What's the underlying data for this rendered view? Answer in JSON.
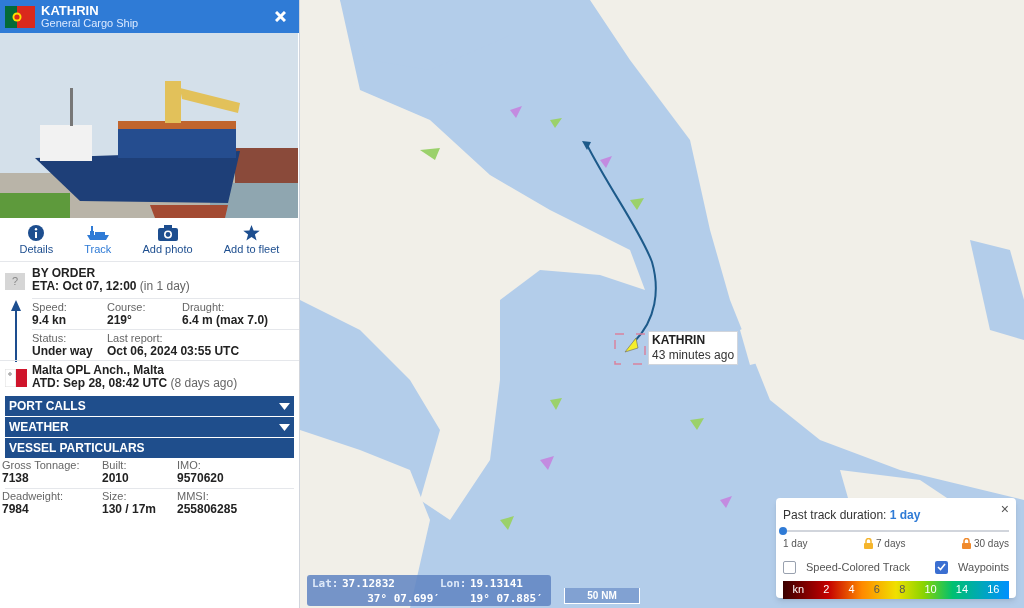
{
  "vessel": {
    "name": "KATHRIN",
    "type": "General Cargo Ship"
  },
  "actions": [
    {
      "kind": "info",
      "label": "Details"
    },
    {
      "kind": "track",
      "label": "Track"
    },
    {
      "kind": "camera",
      "label": "Add photo"
    },
    {
      "kind": "star",
      "label": "Add to fleet"
    }
  ],
  "voyage": {
    "destination_flag": "?",
    "destination": "BY ORDER",
    "eta": "ETA: Oct 07, 12:00",
    "eta_note": "(in 1 day)",
    "stats": [
      [
        {
          "label": "Speed:",
          "value": "9.4 kn"
        },
        {
          "label": "Course:",
          "value": "219°"
        },
        {
          "label": "Draught:",
          "value": "6.4 m (max 7.0)"
        }
      ],
      [
        {
          "label": "Status:",
          "value": "Under way"
        },
        {
          "label": "Last report:",
          "value": "Oct 06, 2024 03:55 UTC"
        }
      ]
    ],
    "departure": "Malta OPL Anch., Malta",
    "atd": "ATD: Sep 28, 08:42 UTC",
    "atd_note": "(8 days ago)"
  },
  "sections": [
    {
      "title": "PORT CALLS",
      "expanded": false
    },
    {
      "title": "WEATHER",
      "expanded": false
    },
    {
      "title": "VESSEL PARTICULARS",
      "expanded": true
    }
  ],
  "particulars": [
    [
      {
        "label": "Gross Tonnage:",
        "value": "7138"
      },
      {
        "label": "Built:",
        "value": "2010"
      },
      {
        "label": "IMO:",
        "value": "9570620"
      }
    ],
    [
      {
        "label": "Deadweight:",
        "value": "7984"
      },
      {
        "label": "Size:",
        "value": "130 / 17m"
      },
      {
        "label": "MMSI:",
        "value": "255806285"
      }
    ]
  ],
  "map": {
    "kind": "picture",
    "tooltip": {
      "name": "KATHRIN",
      "time": "43 minutes ago"
    },
    "coordinates": {
      "lat_label": "Lat:",
      "lat": "37.12832",
      "lat_dms": "37° 07.699′",
      "lon_label": "Lon:",
      "lon": "19.13141",
      "lon_dms": "19° 07.885′"
    },
    "scale": "50 NM"
  },
  "track_panel": {
    "title": "Past track duration:",
    "value": "1 day",
    "close": "×",
    "slider": {
      "level": 0
    },
    "ticks": [
      {
        "label": "1 day",
        "locked": false
      },
      {
        "label": "7 days",
        "locked": true
      },
      {
        "label": "30 days",
        "locked": true
      }
    ],
    "options": [
      {
        "label": "Speed-Colored Track",
        "checked": false
      },
      {
        "label": "Waypoints",
        "checked": true
      }
    ],
    "legend": [
      "kn",
      "2",
      "4",
      "6",
      "8",
      "10",
      "14",
      "16"
    ]
  }
}
